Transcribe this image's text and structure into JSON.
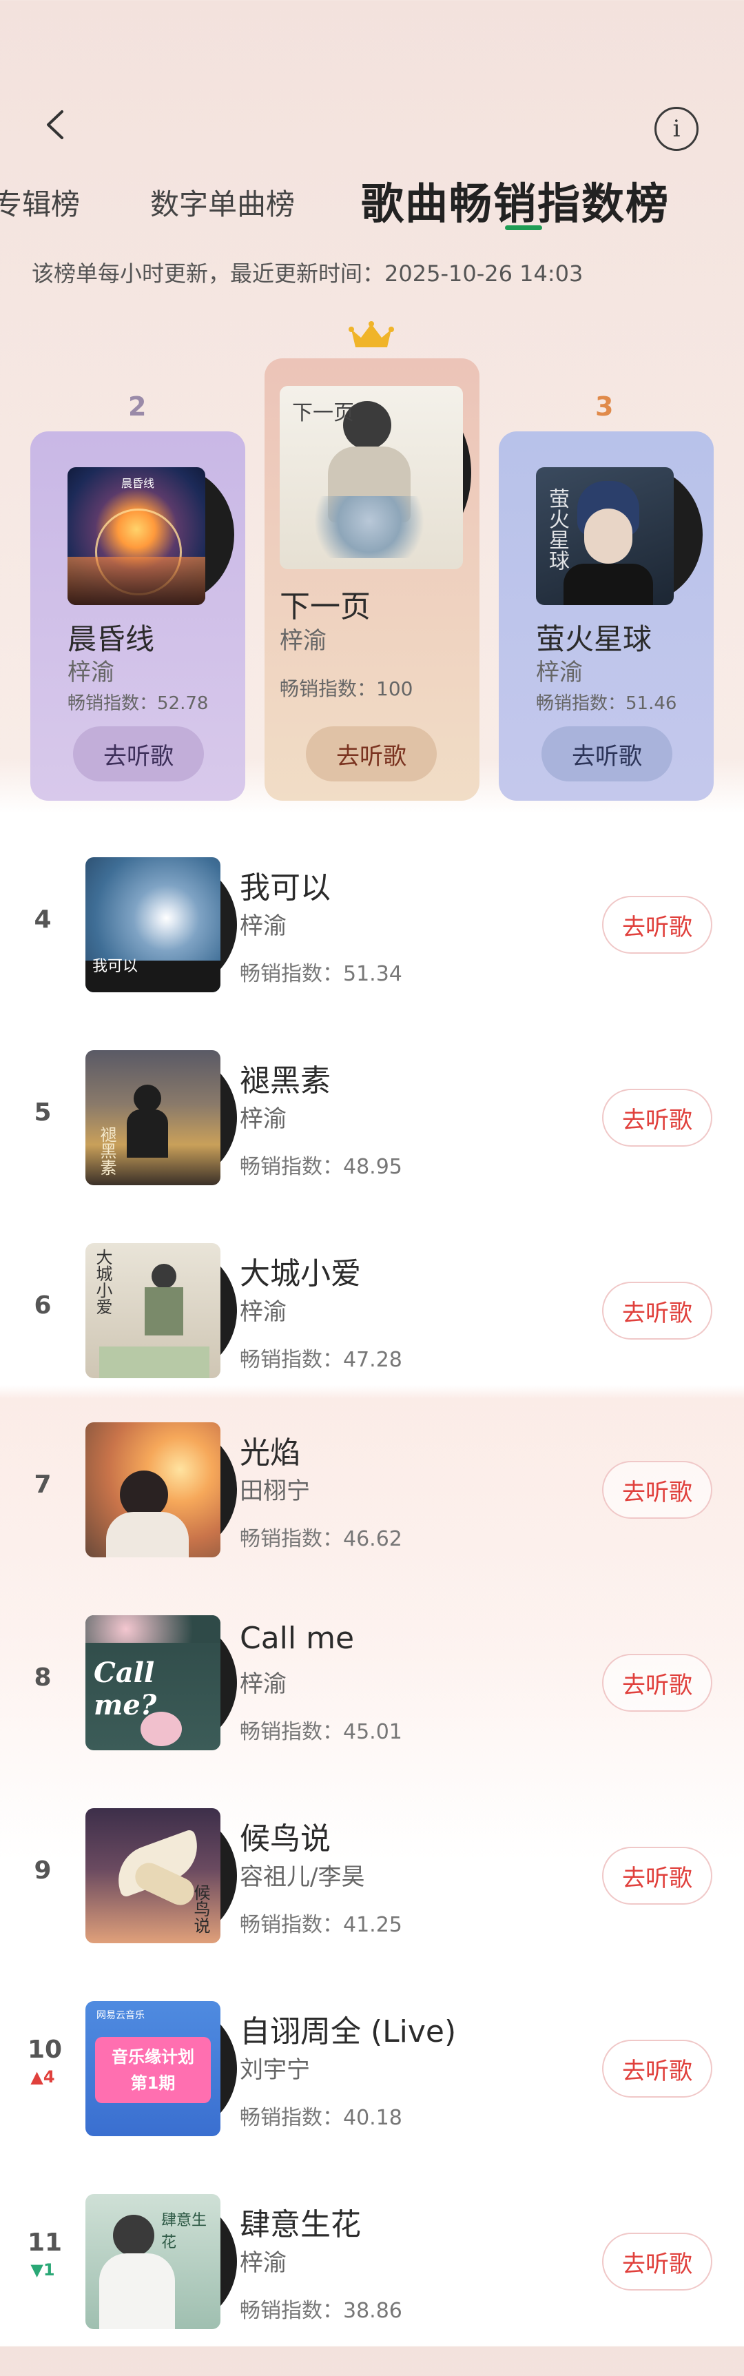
{
  "header": {
    "tabs": [
      {
        "label": "专辑榜"
      },
      {
        "label": "数字单曲榜"
      },
      {
        "label": "歌曲畅销指数榜"
      }
    ],
    "update_info": "该榜单每小时更新，最近更新时间：2025-10-26 14:03"
  },
  "podium": [
    {
      "rank": "2",
      "title": "晨昏线",
      "artist": "梓渝",
      "index": "畅销指数：52.78",
      "button": "去听歌",
      "art_text": "晨昏线"
    },
    {
      "rank": "1",
      "title": "下一页",
      "artist": "梓渝",
      "index": "畅销指数：100",
      "button": "去听歌",
      "art_text": "下一页"
    },
    {
      "rank": "3",
      "title": "萤火星球",
      "artist": "梓渝",
      "index": "畅销指数：51.46",
      "button": "去听歌",
      "art_text": "萤火星球"
    }
  ],
  "list": [
    {
      "rank": "4",
      "change": "",
      "title": "我可以",
      "artist": "梓渝",
      "index": "畅销指数：51.34",
      "button": "去听歌",
      "art_text": "我可以"
    },
    {
      "rank": "5",
      "change": "",
      "title": "褪黑素",
      "artist": "梓渝",
      "index": "畅销指数：48.95",
      "button": "去听歌",
      "art_text": "褪黑素"
    },
    {
      "rank": "6",
      "change": "",
      "title": "大城小爱",
      "artist": "梓渝",
      "index": "畅销指数：47.28",
      "button": "去听歌",
      "art_text": "大城小爱"
    },
    {
      "rank": "7",
      "change": "",
      "title": "光焰",
      "artist": "田栩宁",
      "index": "畅销指数：46.62",
      "button": "去听歌",
      "art_text": ""
    },
    {
      "rank": "8",
      "change": "",
      "title": "Call me",
      "artist": "梓渝",
      "index": "畅销指数：45.01",
      "button": "去听歌",
      "art_text": "Call me?"
    },
    {
      "rank": "9",
      "change": "",
      "title": "候鸟说",
      "artist": "容祖儿/李昊",
      "index": "畅销指数：41.25",
      "button": "去听歌",
      "art_text": "候鸟说"
    },
    {
      "rank": "10",
      "change": "▲4",
      "title": "自诩周全 (Live)",
      "artist": "刘宇宁",
      "index": "畅销指数：40.18",
      "button": "去听歌",
      "art_text": "音乐缘计划 第1期",
      "art_text2": "网易云音乐"
    },
    {
      "rank": "11",
      "change": "▼1",
      "title": "肆意生花",
      "artist": "梓渝",
      "index": "畅销指数：38.86",
      "button": "去听歌",
      "art_text": "肆意生花"
    }
  ],
  "colors": {
    "accent_red": "#e0403c",
    "tab_underline": "#1f9d55",
    "up": "#e0403c",
    "down": "#2aa876",
    "crown": "#f0b429"
  }
}
